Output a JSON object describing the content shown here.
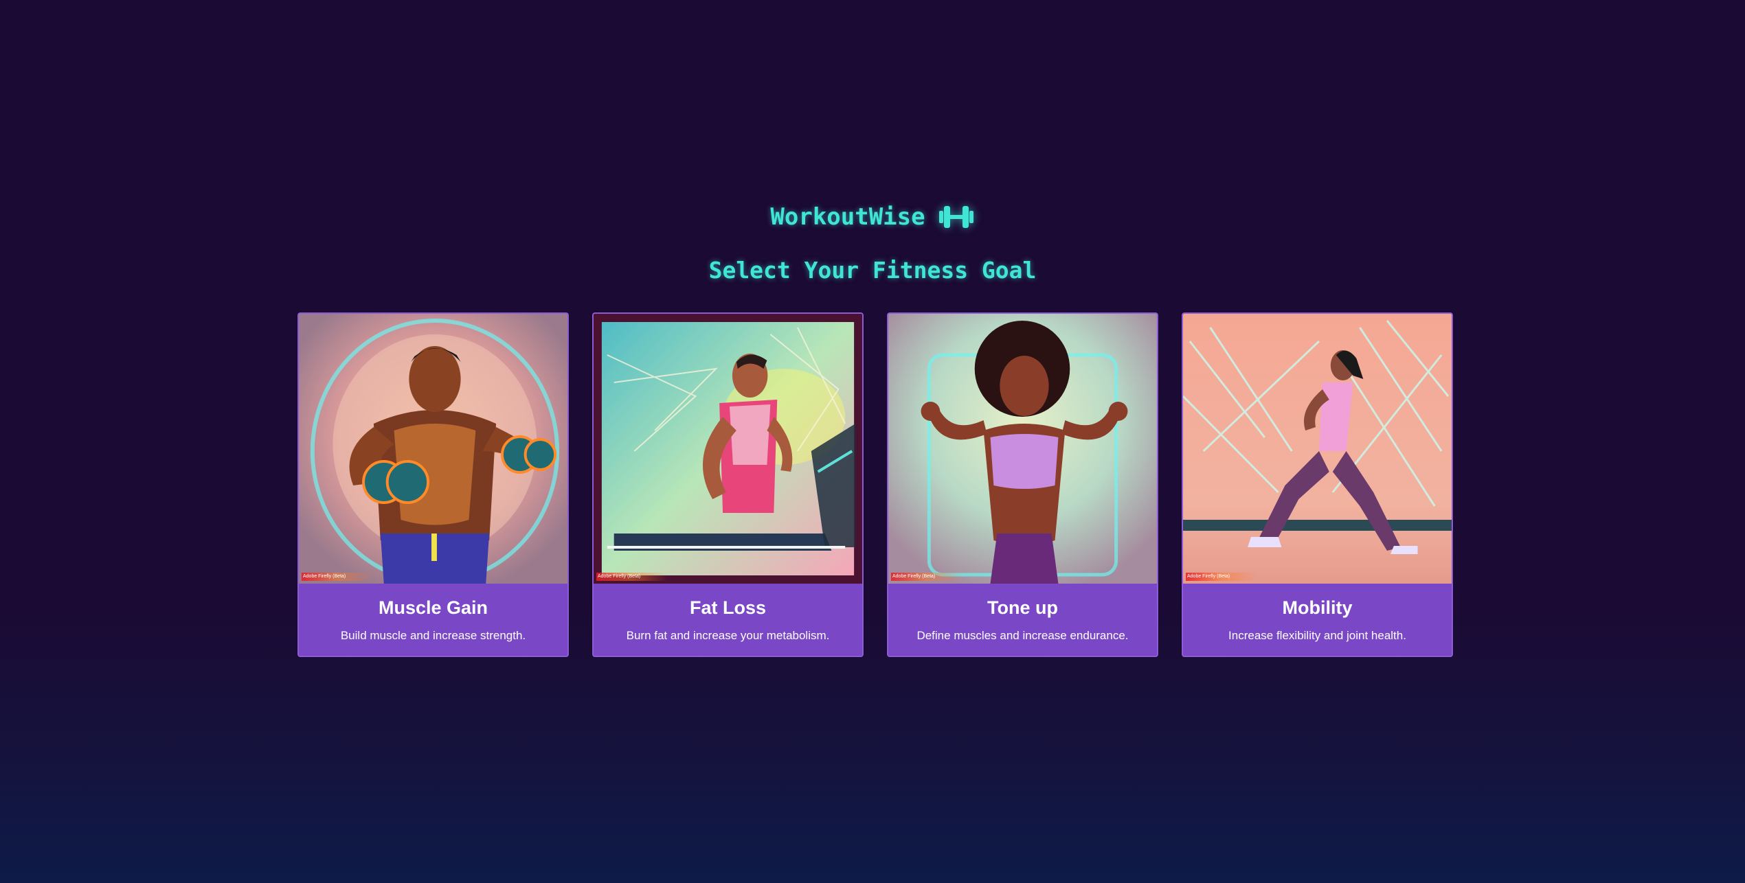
{
  "header": {
    "app_title": "WorkoutWise",
    "subtitle": "Select Your Fitness Goal",
    "icon": "dumbbell-icon"
  },
  "colors": {
    "background": "#1b0a33",
    "accent": "#3fe6d6",
    "card": "#7a47c6"
  },
  "cards": [
    {
      "title": "Muscle Gain",
      "description": "Build muscle and increase strength.",
      "image": "muscle-gain-illustration",
      "badge": "Adobe Firefly (Beta)"
    },
    {
      "title": "Fat Loss",
      "description": "Burn fat and increase your metabolism.",
      "image": "fat-loss-illustration",
      "badge": "Adobe Firefly (Beta)"
    },
    {
      "title": "Tone up",
      "description": "Define muscles and increase endurance.",
      "image": "tone-up-illustration",
      "badge": "Adobe Firefly (Beta)"
    },
    {
      "title": "Mobility",
      "description": "Increase flexibility and joint health.",
      "image": "mobility-illustration",
      "badge": "Adobe Firefly (Beta)"
    }
  ]
}
